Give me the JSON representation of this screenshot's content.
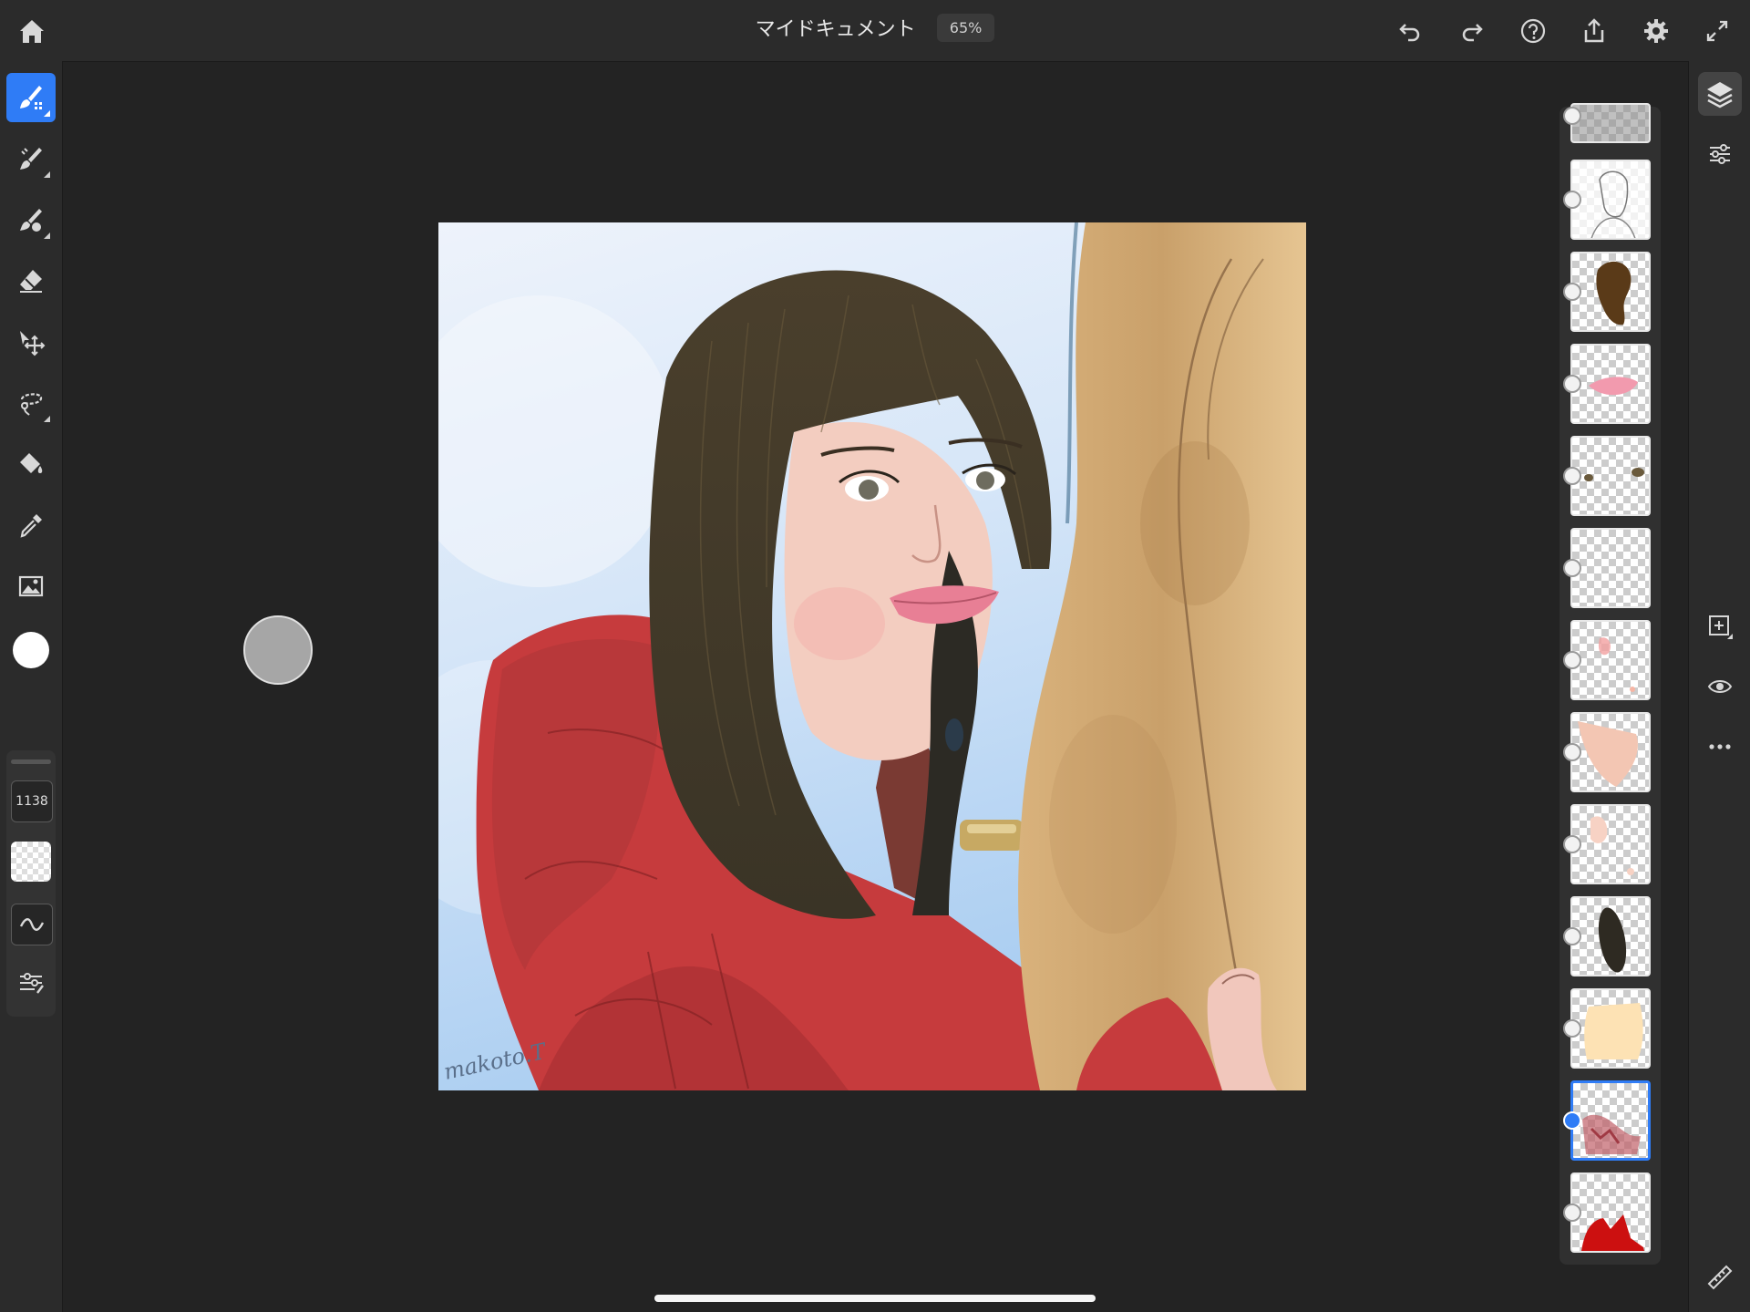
{
  "app": {
    "document_title": "マイドキュメント",
    "zoom": "65%"
  },
  "toolbar_left": {
    "brush_size": "1138",
    "tools": [
      "paint-brush",
      "smudge",
      "mix-brush",
      "eraser",
      "move",
      "lasso",
      "fill",
      "eyedropper",
      "place-image"
    ],
    "color": "#ffffff"
  },
  "canvas": {
    "signature": "makoto.T"
  },
  "layers": {
    "count": 13,
    "selected_index": 11
  },
  "colors": {
    "accent": "#2f7cf6",
    "coat_red": "#c23a3c",
    "hair_brown": "#4e4230",
    "skin": "#f4cbbf",
    "tan": "#c8a06a"
  }
}
